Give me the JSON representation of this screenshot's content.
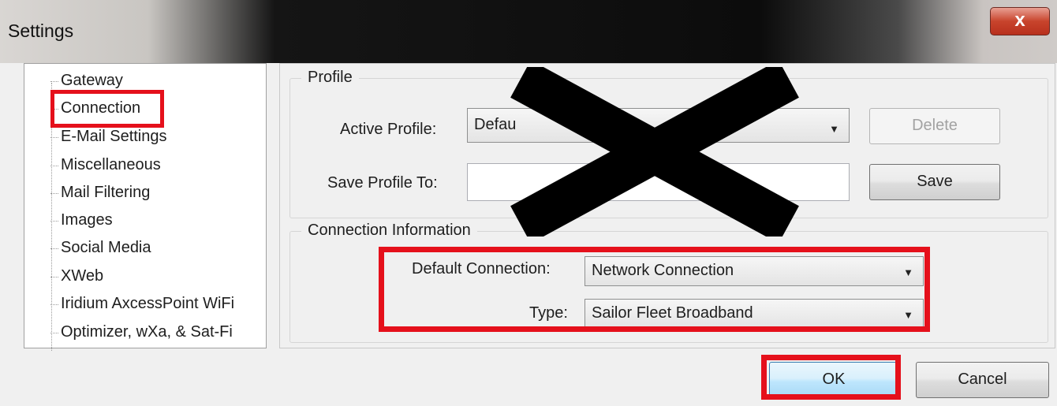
{
  "window": {
    "title": "Settings",
    "close_glyph": "x"
  },
  "sidebar": {
    "items": [
      {
        "label": "Gateway"
      },
      {
        "label": "Connection",
        "selected": true
      },
      {
        "label": "E-Mail Settings"
      },
      {
        "label": "Miscellaneous"
      },
      {
        "label": "Mail Filtering"
      },
      {
        "label": "Images"
      },
      {
        "label": "Social Media"
      },
      {
        "label": "XWeb"
      },
      {
        "label": "Iridium AxcessPoint WiFi"
      },
      {
        "label": "Optimizer, wXa, & Sat-Fi"
      }
    ]
  },
  "profile": {
    "group_title": "Profile",
    "active_profile_label": "Active Profile:",
    "active_profile_value": "Defau",
    "save_profile_label": "Save Profile To:",
    "save_profile_value": "",
    "delete_label": "Delete",
    "save_label": "Save"
  },
  "connection": {
    "group_title": "Connection Information",
    "default_connection_label": "Default Connection:",
    "default_connection_value": "Network Connection",
    "type_label": "Type:",
    "type_value": "Sailor Fleet Broadband"
  },
  "footer": {
    "ok_label": "OK",
    "cancel_label": "Cancel"
  },
  "colors": {
    "highlight": "#e5101b",
    "x_mark": "#000000"
  },
  "icons": {
    "dropdown": "chevron-down-icon",
    "close": "close-icon"
  }
}
